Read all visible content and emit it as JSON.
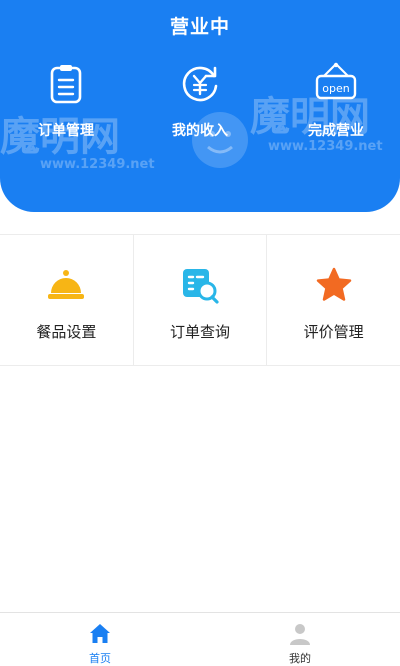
{
  "header": {
    "title": "营业中",
    "actions": [
      {
        "label": "订单管理",
        "icon": "clipboard-icon"
      },
      {
        "label": "我的收入",
        "icon": "yuan-income-icon"
      },
      {
        "label": "完成营业",
        "icon": "open-sign-icon",
        "sign_text": "open"
      }
    ]
  },
  "watermark": {
    "brand": "魔明网",
    "url": "www.12349.net"
  },
  "grid": [
    {
      "label": "餐品设置",
      "icon": "food-cloche-icon"
    },
    {
      "label": "订单查询",
      "icon": "order-search-icon"
    },
    {
      "label": "评价管理",
      "icon": "star-icon"
    }
  ],
  "tabbar": [
    {
      "label": "首页",
      "icon": "home-icon",
      "active": true
    },
    {
      "label": "我的",
      "icon": "user-icon",
      "active": false
    }
  ],
  "colors": {
    "primary": "#1a7ff2",
    "food_icon": "#f7b515",
    "search_icon": "#29b6e8",
    "star_icon": "#f26a22",
    "tab_inactive_icon": "#c8c8c8"
  }
}
